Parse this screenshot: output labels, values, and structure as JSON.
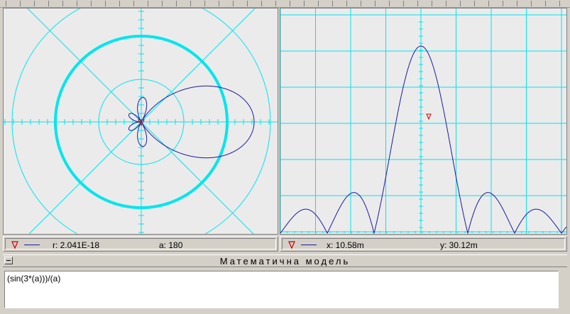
{
  "polar_status": {
    "r_label": "r: 2.041E-18",
    "a_label": "a: 180"
  },
  "rect_status": {
    "x_label": "x: 10.58m",
    "y_label": "y: 30.12m"
  },
  "section": {
    "title": "Математична модель"
  },
  "formula": {
    "value": "(sin(3*(a)))/(a)"
  },
  "colors": {
    "grid": "#00e5ee",
    "curve": "#1a1aa0",
    "cursor": "#cc0000",
    "panel_bg": "#ebebeb",
    "window_bg": "#d4d0c8"
  },
  "chart_data": [
    {
      "type": "line",
      "title": "",
      "plot": "polar",
      "function": "(sin(3*(a)))/(a)",
      "grid": true,
      "cursor": {
        "r": "2.041E-18",
        "a": 180
      }
    },
    {
      "type": "line",
      "title": "",
      "plot": "rectangular",
      "function": "(sin(3*(a)))/(a)",
      "grid": true,
      "cursor": {
        "x": "10.58m",
        "y": "30.12m"
      }
    }
  ]
}
